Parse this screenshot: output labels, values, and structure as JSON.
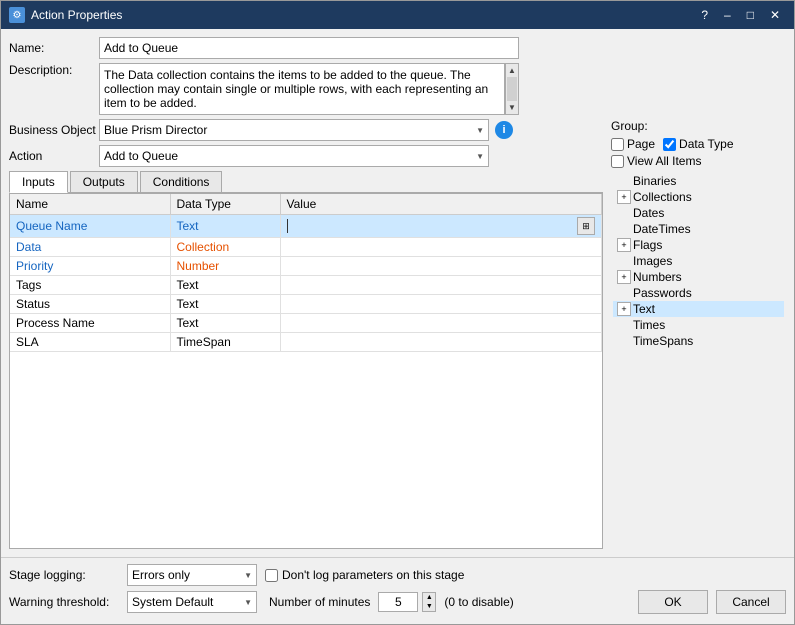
{
  "window": {
    "title": "Action Properties",
    "icon": "⚙"
  },
  "header": {
    "name_label": "Name:",
    "name_value": "Add to Queue",
    "description_label": "Description:",
    "description_value": "The Data collection contains the items to be added to the queue. The collection may contain single or multiple rows, with each representing an item to be added."
  },
  "business_object": {
    "label": "Business Object",
    "value": "Blue Prism Director",
    "info_icon": "i"
  },
  "action": {
    "label": "Action",
    "value": "Add to Queue"
  },
  "tabs": [
    {
      "label": "Inputs",
      "active": true
    },
    {
      "label": "Outputs",
      "active": false
    },
    {
      "label": "Conditions",
      "active": false
    }
  ],
  "table": {
    "columns": [
      "Name",
      "Data Type",
      "Value"
    ],
    "rows": [
      {
        "name": "Queue Name",
        "dataType": "Text",
        "value": "",
        "selected": true,
        "name_color": "blue",
        "type_color": "blue"
      },
      {
        "name": "Data",
        "dataType": "Collection",
        "value": "",
        "selected": false,
        "name_color": "blue",
        "type_color": "orange"
      },
      {
        "name": "Priority",
        "dataType": "Number",
        "value": "",
        "selected": false,
        "name_color": "blue",
        "type_color": "orange"
      },
      {
        "name": "Tags",
        "dataType": "Text",
        "value": "",
        "selected": false,
        "name_color": "normal",
        "type_color": "normal"
      },
      {
        "name": "Status",
        "dataType": "Text",
        "value": "",
        "selected": false,
        "name_color": "normal",
        "type_color": "normal"
      },
      {
        "name": "Process Name",
        "dataType": "Text",
        "value": "",
        "selected": false,
        "name_color": "normal",
        "type_color": "normal"
      },
      {
        "name": "SLA",
        "dataType": "TimeSpan",
        "value": "",
        "selected": false,
        "name_color": "normal",
        "type_color": "normal"
      }
    ]
  },
  "right_panel": {
    "group_label": "Group:",
    "checkboxes": [
      {
        "id": "page",
        "label": "Page",
        "checked": false
      },
      {
        "id": "datatype",
        "label": "Data Type",
        "checked": true
      }
    ],
    "view_all": {
      "label": "View All Items",
      "checked": false
    },
    "tree": [
      {
        "label": "Binaries",
        "expandable": false,
        "indent": 0
      },
      {
        "label": "Collections",
        "expandable": true,
        "indent": 0
      },
      {
        "label": "Dates",
        "expandable": false,
        "indent": 0
      },
      {
        "label": "DateTimes",
        "expandable": false,
        "indent": 0
      },
      {
        "label": "Flags",
        "expandable": true,
        "indent": 0
      },
      {
        "label": "Images",
        "expandable": false,
        "indent": 0
      },
      {
        "label": "Numbers",
        "expandable": true,
        "indent": 0
      },
      {
        "label": "Passwords",
        "expandable": false,
        "indent": 0
      },
      {
        "label": "Text",
        "expandable": true,
        "indent": 0,
        "selected": true
      },
      {
        "label": "Times",
        "expandable": false,
        "indent": 0
      },
      {
        "label": "TimeSpans",
        "expandable": false,
        "indent": 0
      }
    ]
  },
  "bottom": {
    "stage_logging_label": "Stage logging:",
    "stage_logging_value": "Errors only",
    "dont_log_label": "Don't log parameters on this stage",
    "dont_log_checked": false,
    "warning_threshold_label": "Warning threshold:",
    "warning_threshold_value": "System Default",
    "number_of_minutes_label": "Number of minutes",
    "minutes_value": "5",
    "zero_to_disable": "(0 to disable)",
    "ok_btn": "OK",
    "cancel_btn": "Cancel"
  }
}
